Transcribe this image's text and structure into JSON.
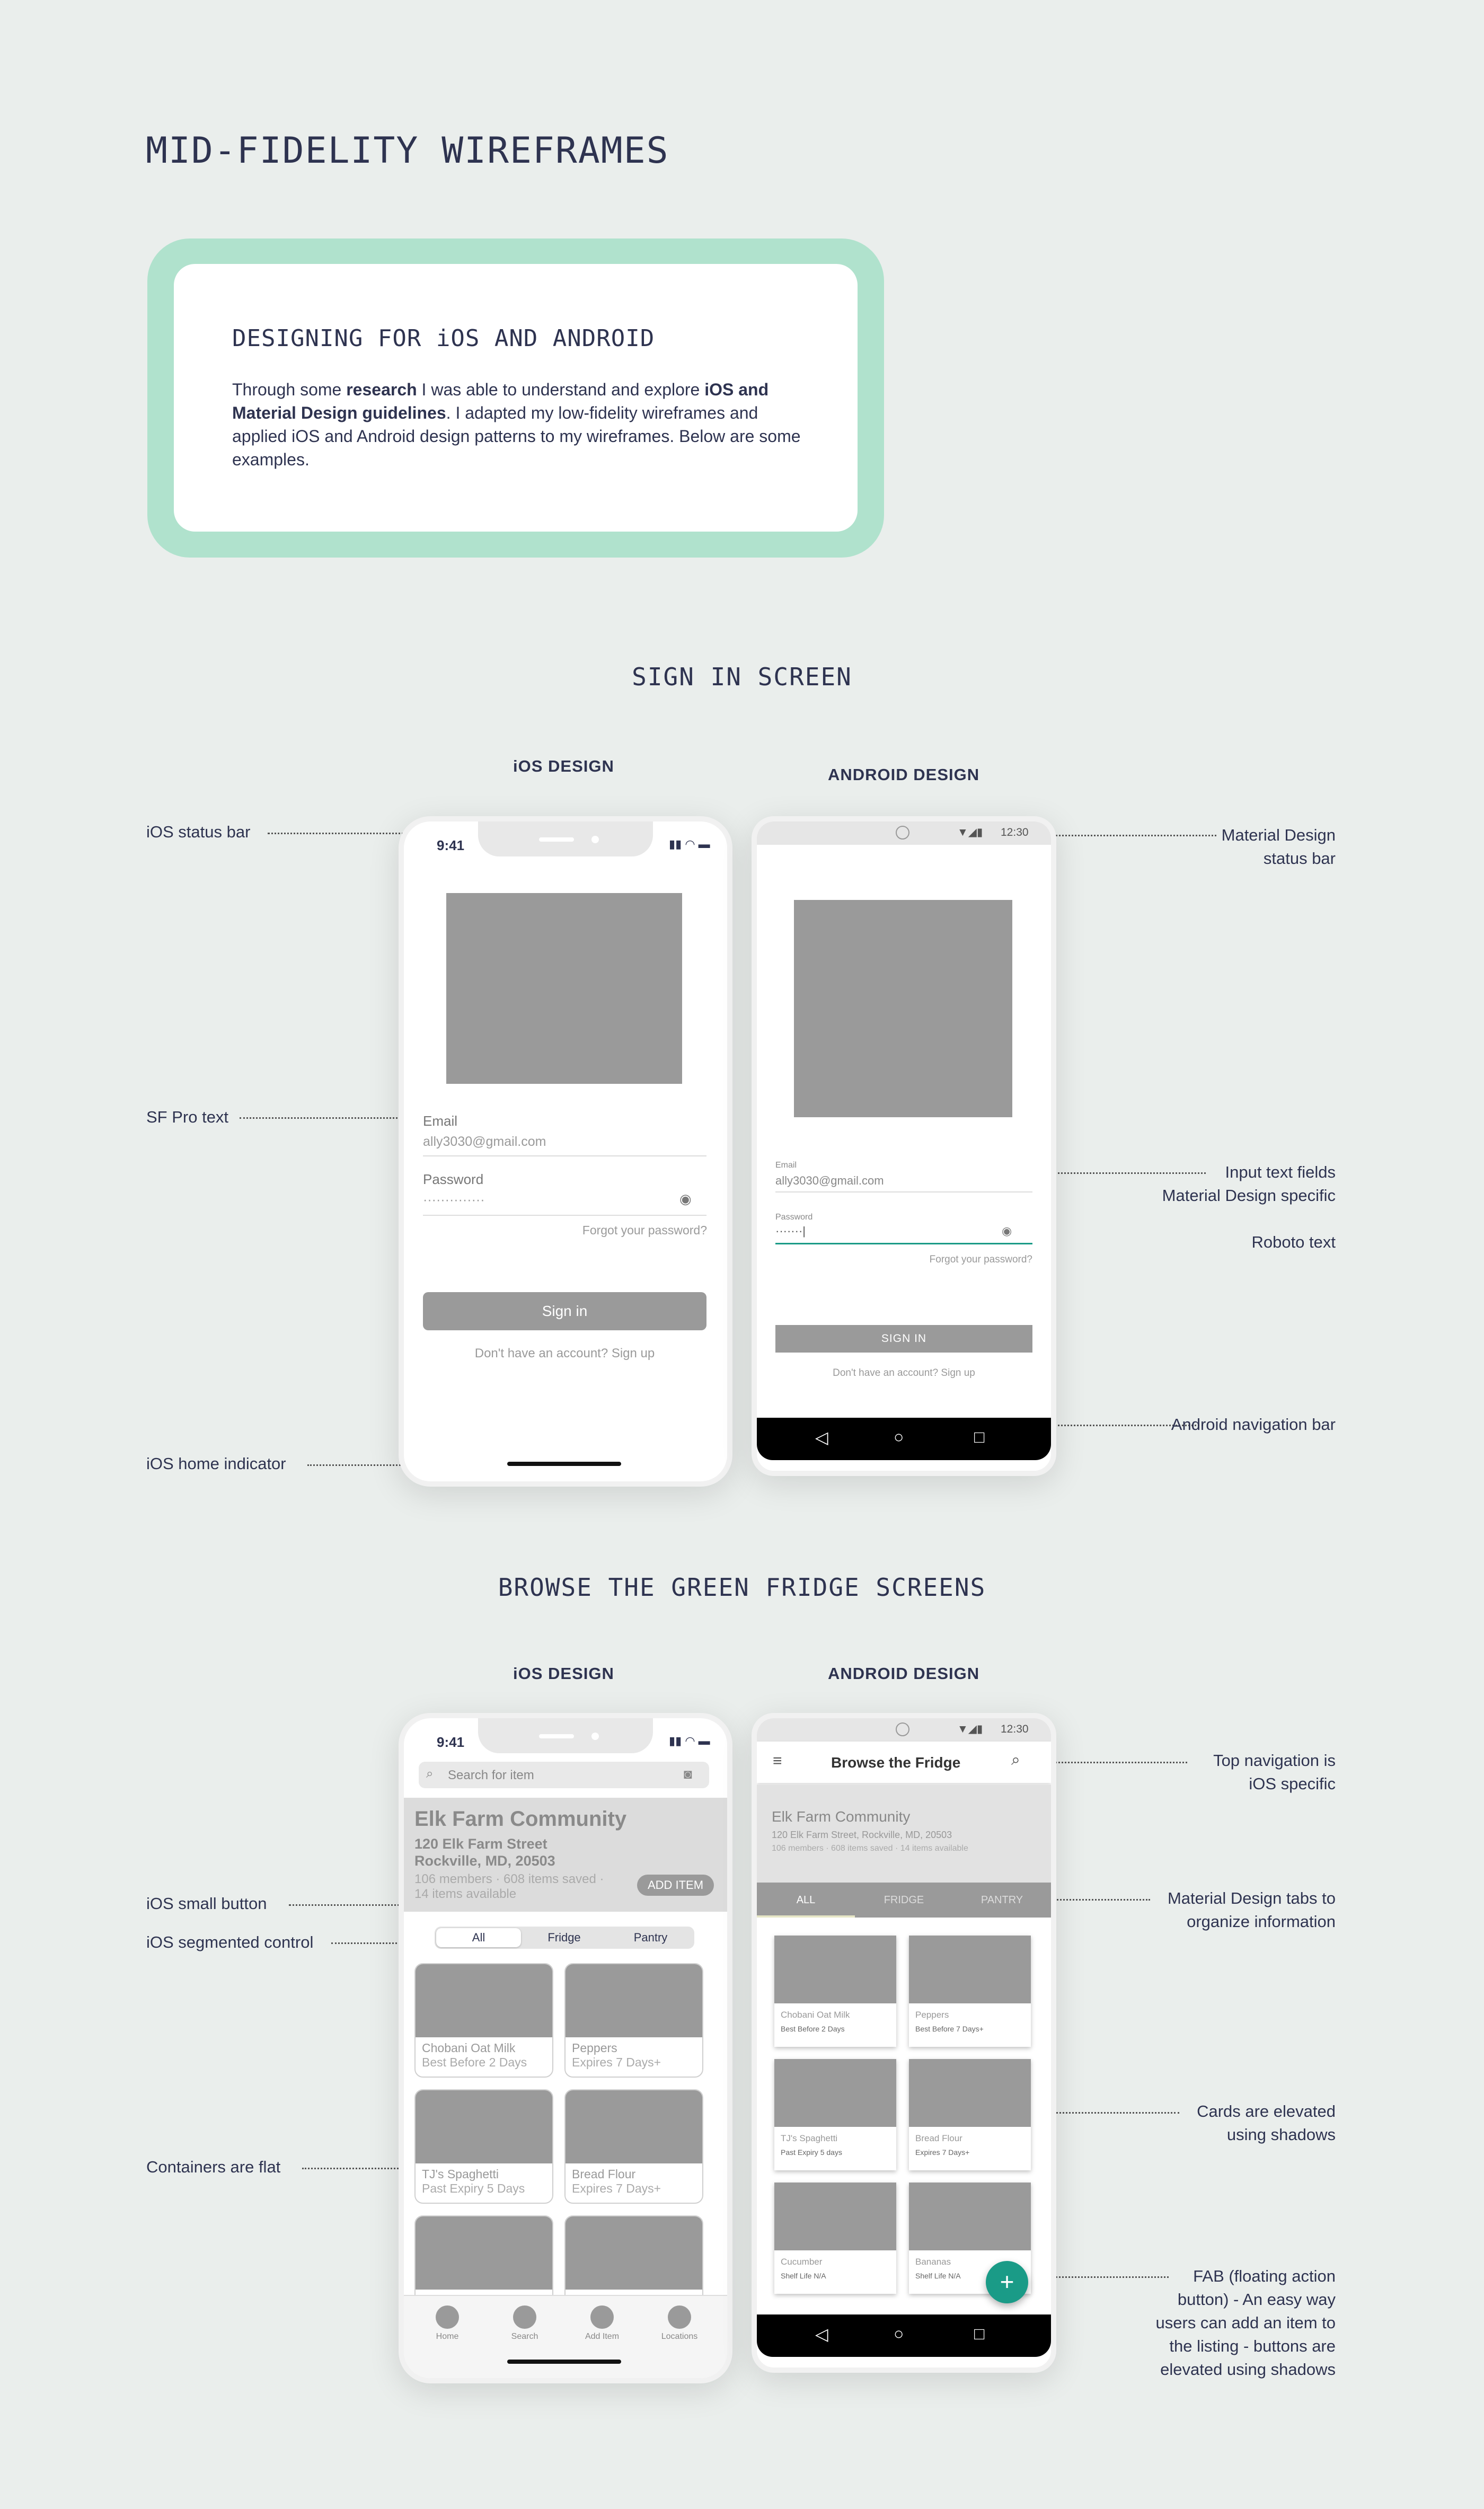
{
  "page": {
    "title": "MID-FIDELITY WIREFRAMES",
    "intro": {
      "heading": "DESIGNING FOR iOS AND ANDROID",
      "p1": "Through some ",
      "p2": "research",
      "p3": " I was able to understand and explore ",
      "p4": "iOS and Material Design guidelines",
      "p5": ". I adapted my low-fidelity wireframes and applied iOS and Android design patterns to my wireframes. Below are some examples."
    },
    "signin_section": "SIGN IN SCREEN",
    "browse_section": "BROWSE THE GREEN FRIDGE SCREENS",
    "ios_label": "iOS DESIGN",
    "android_label": "ANDROID DESIGN"
  },
  "annotations": {
    "ios_status_bar": "iOS status bar",
    "sf_pro": "SF Pro text",
    "ios_home_indicator": "iOS home indicator",
    "md_status_bar_1": "Material Design",
    "md_status_bar_2": "status bar",
    "input_fields_1": "Input text fields",
    "input_fields_2": "Material Design specific",
    "roboto": "Roboto text",
    "android_nav": "Android navigation bar",
    "ios_small_button": "iOS small button",
    "ios_segmented": "iOS segmented control",
    "containers_flat": "Containers are flat",
    "top_nav_1": "Top navigation is",
    "top_nav_2": "iOS specific",
    "md_tabs_1": "Material Design tabs to",
    "md_tabs_2": "organize information",
    "cards_1": "Cards are elevated",
    "cards_2": "using shadows",
    "fab_1": "FAB (floating action",
    "fab_2": "button) - An easy way",
    "fab_3": "users can add an item to",
    "fab_4": "the listing - buttons are",
    "fab_5": "elevated using shadows"
  },
  "signin_ios": {
    "time": "9:41",
    "email_label": "Email",
    "email_value": "ally3030@gmail.com",
    "password_label": "Password",
    "password_value": "··············",
    "forgot": "Forgot your password?",
    "signin_button": "Sign in",
    "signup": "Don't have an account? Sign up"
  },
  "signin_android": {
    "time": "12:30",
    "email_label": "Email",
    "email_value": "ally3030@gmail.com",
    "password_label": "Password",
    "password_value": "·······|",
    "forgot": "Forgot your password?",
    "signin_button": "SIGN IN",
    "signup": "Don't have an account? Sign up"
  },
  "browse_ios": {
    "time": "9:41",
    "search_placeholder": "Search for item",
    "community": "Elk Farm Community",
    "address1": "120 Elk Farm Street",
    "address2": "Rockville, MD, 20503",
    "stats": "106 members · 608 items saved ·",
    "available": "14 items available",
    "add_item": "ADD ITEM",
    "segments": [
      "All",
      "Fridge",
      "Pantry"
    ],
    "cards": [
      {
        "name": "Chobani Oat Milk",
        "sub": "Best Before 2 Days"
      },
      {
        "name": "Peppers",
        "sub": "Expires 7 Days+"
      },
      {
        "name": "TJ's Spaghetti",
        "sub": "Past Expiry 5 Days"
      },
      {
        "name": "Bread Flour",
        "sub": "Expires 7 Days+"
      }
    ],
    "tabs": [
      "Home",
      "Search",
      "Add Item",
      "Locations"
    ]
  },
  "browse_android": {
    "time": "12:30",
    "title": "Browse the Fridge",
    "community": "Elk Farm Community",
    "address": "120 Elk Farm Street, Rockville, MD, 20503",
    "stats": "106 members · 608 items saved · 14 items available",
    "tabs": [
      "ALL",
      "FRIDGE",
      "PANTRY"
    ],
    "cards": [
      {
        "name": "Chobani Oat Milk",
        "sub": "Best Before 2 Days"
      },
      {
        "name": "Peppers",
        "sub": "Best Before 7 Days+"
      },
      {
        "name": "TJ's Spaghetti",
        "sub": "Past Expiry 5 days"
      },
      {
        "name": "Bread Flour",
        "sub": "Expires 7 Days+"
      },
      {
        "name": "Cucumber",
        "sub": "Shelf Life N/A"
      },
      {
        "name": "Bananas",
        "sub": "Shelf Life N/A"
      }
    ],
    "fab": "+"
  }
}
